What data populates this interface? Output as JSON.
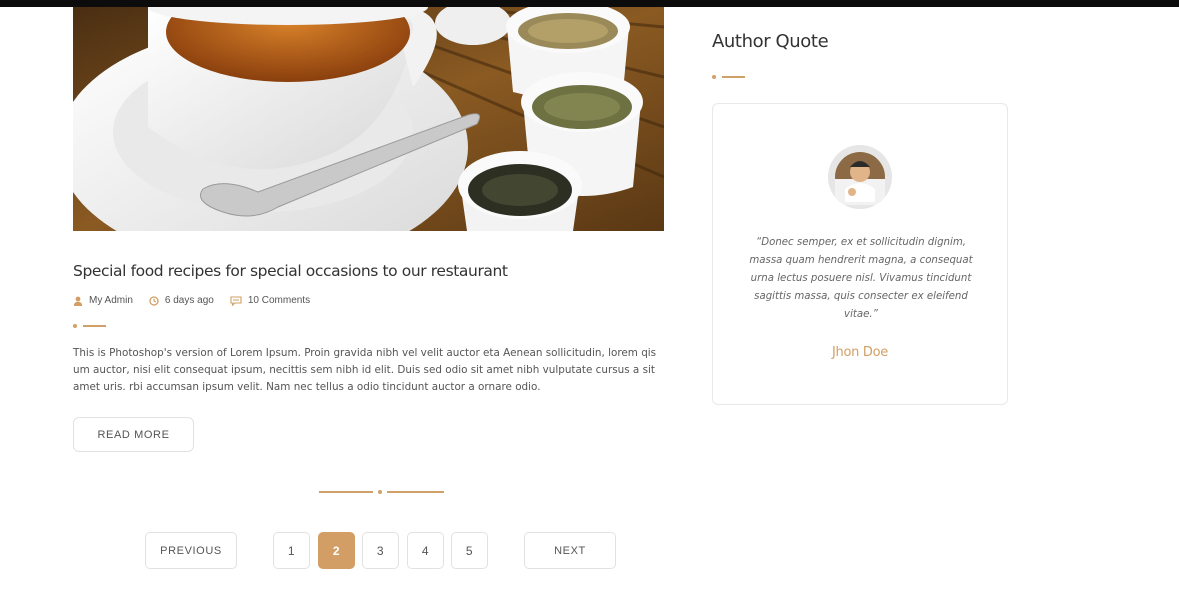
{
  "post": {
    "title": "Special food recipes for special occasions to our restaurant",
    "meta": {
      "author": "My Admin",
      "date": "6 days ago",
      "comments": "10 Comments"
    },
    "excerpt": "This is Photoshop's version of Lorem Ipsum. Proin gravida nibh vel velit auctor eta Aenean sollicitudin, lorem qis um auctor, nisi elit consequat ipsum, necittis sem nibh id elit. Duis sed odio sit amet nibh vulputate cursus a sit amet uris. rbi accumsan ipsum velit. Nam nec tellus a odio tincidunt auctor a ornare odio.",
    "read_more_label": "READ MORE"
  },
  "pagination": {
    "previous_label": "PREVIOUS",
    "next_label": "NEXT",
    "pages": [
      "1",
      "2",
      "3",
      "4",
      "5"
    ],
    "current_page": "2"
  },
  "sidebar": {
    "title": "Author Quote",
    "quote": "“Donec semper, ex et sollicitudin dignim, massa quam hendrerit magna, a consequat urna lectus posuere nisl. Vivamus tincidunt sagittis massa, quis consecter ex eleifend vitae.”",
    "author": "Jhon Doe"
  },
  "colors": {
    "accent": "#d29e65",
    "heading": "#333333",
    "text": "#555555",
    "border": "#e2e2e2",
    "topbar": "#0c0c0c"
  },
  "icons": {
    "author": "user-icon",
    "date": "clock-icon",
    "comments": "comment-icon"
  }
}
